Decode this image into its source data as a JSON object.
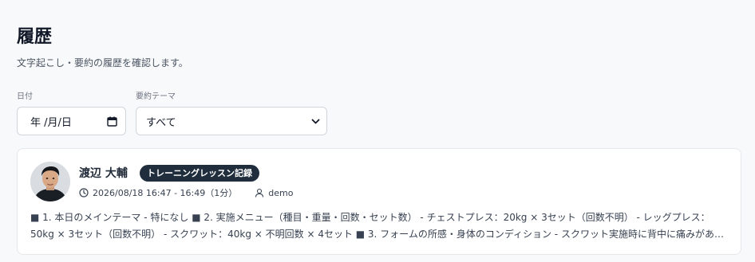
{
  "header": {
    "title": "履歴",
    "subtitle": "文字起こし・要約の履歴を確認します。"
  },
  "filters": {
    "date_label": "日付",
    "date_placeholder": "年 /月/日",
    "theme_label": "要約テーマ",
    "theme_selected": "すべて"
  },
  "history": [
    {
      "name": "渡辺 大輔",
      "tag": "トレーニングレッスン記録",
      "datetime": "2026/08/18 16:47 - 16:49（1分）",
      "user": "demo",
      "summary": "■ 1. 本日のメインテーマ - 特になし ■ 2. 実施メニュー（種目・重量・回数・セット数） - チェストプレス：20kg × 3セット（回数不明） - レッグプレス：50kg × 3セット（回数不明） - スクワット：40kg × 不明回数 × 4セット ■ 3. フォームの所感・身体のコンディション - スクワット実施時に背中に痛みがあったため、注..."
    }
  ],
  "icons": {
    "date": "calendar-icon",
    "select": "chevron-down-icon",
    "time": "clock-icon",
    "user": "user-icon"
  },
  "colors": {
    "badge_bg": "#1f2d3d",
    "page_bg": "#f8f9fa"
  }
}
